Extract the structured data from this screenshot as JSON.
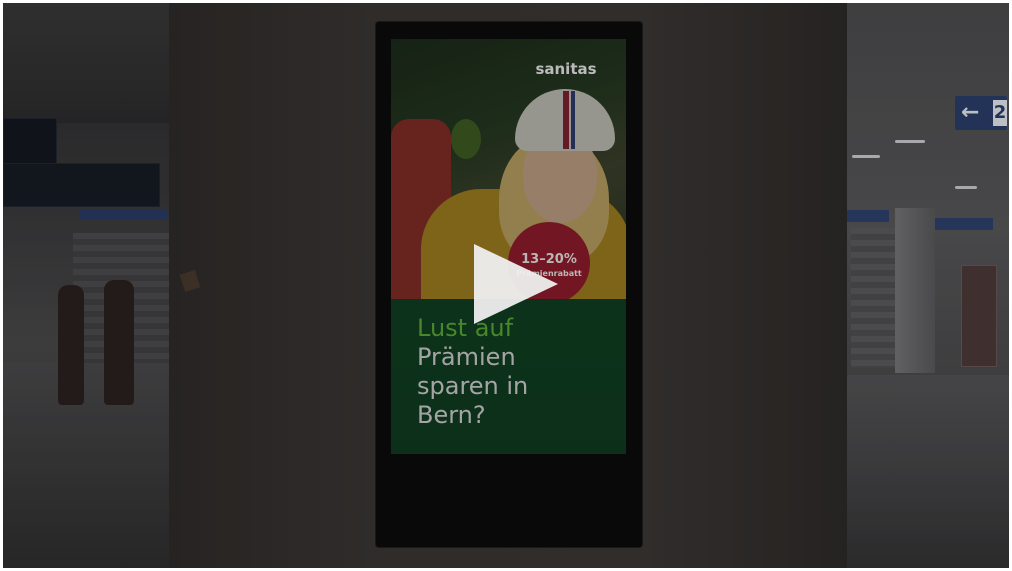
{
  "video": {
    "ad": {
      "brand": "sanitas",
      "badge": {
        "percent": "13–20%",
        "label": "Prämienrabatt"
      },
      "headline": {
        "line1": "Lust auf",
        "line2": "Prämien",
        "line3": "sparen in",
        "line4": "Bern?"
      }
    },
    "station_sign": {
      "arrow": "←",
      "platform": "2"
    },
    "colors": {
      "ad_green": "#103e21",
      "headline_accent": "#5aa533",
      "badge_red": "#8b1c2d",
      "sign_blue": "#2b3d6b"
    },
    "play_icon": "play-icon"
  }
}
